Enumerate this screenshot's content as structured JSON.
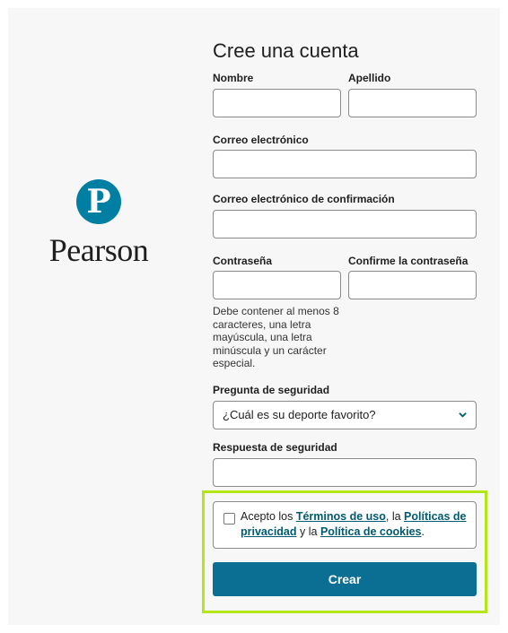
{
  "brand": {
    "name": "Pearson",
    "mark": "P",
    "color": "#007fa3"
  },
  "form": {
    "title": "Cree una cuenta",
    "first_name_label": "Nombre",
    "last_name_label": "Apellido",
    "email_label": "Correo electrónico",
    "email_confirm_label": "Correo electrónico de confirmación",
    "password_label": "Contraseña",
    "password_confirm_label": "Confirme la contraseña",
    "password_hint": "Debe contener al menos 8 caracteres, una letra mayúscula, una letra minúscula y un carácter especial.",
    "security_question_label": "Pregunta de seguridad",
    "security_question_value": "¿Cuál es su deporte favorito?",
    "security_answer_label": "Respuesta de seguridad",
    "first_name_value": "",
    "last_name_value": "",
    "email_value": "",
    "email_confirm_value": "",
    "password_value": "",
    "password_confirm_value": "",
    "security_answer_value": ""
  },
  "terms": {
    "checked": false,
    "prefix": "Acepto los ",
    "terms_link": "Términos de uso",
    "sep1": ", la ",
    "privacy_link": "Políticas de privacidad",
    "sep2": " y la ",
    "cookies_link": "Política de cookies",
    "suffix": "."
  },
  "submit_label": "Crear",
  "colors": {
    "primary_button": "#0b6f93",
    "link": "#005a70",
    "highlight": "#b4e617"
  }
}
